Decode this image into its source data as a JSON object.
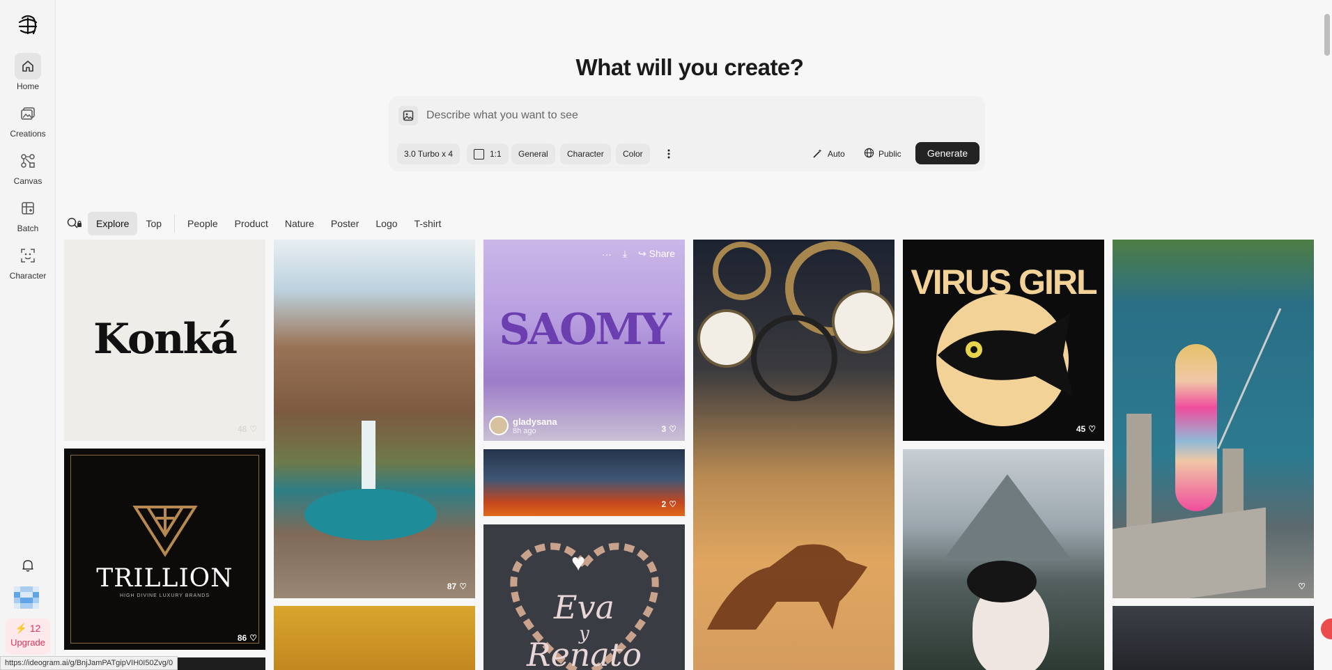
{
  "sidebar": {
    "items": [
      {
        "label": "Home",
        "icon": "home-icon",
        "active": true
      },
      {
        "label": "Creations",
        "icon": "images-icon"
      },
      {
        "label": "Canvas",
        "icon": "canvas-icon"
      },
      {
        "label": "Batch",
        "icon": "batch-icon"
      },
      {
        "label": "Character",
        "icon": "character-icon"
      }
    ],
    "credits": "12",
    "upgrade_label": "Upgrade"
  },
  "header": {
    "title": "What will you create?",
    "placeholder": "Describe what you want to see",
    "model": "3.0 Turbo x 4",
    "aspect": "1:1",
    "chips": [
      "General",
      "Character",
      "Color"
    ],
    "auto_label": "Auto",
    "visibility_label": "Public",
    "generate_label": "Generate"
  },
  "filters": {
    "primary": [
      "Explore",
      "Top"
    ],
    "categories": [
      "People",
      "Product",
      "Nature",
      "Poster",
      "Logo",
      "T-shirt"
    ]
  },
  "gallery": {
    "konka": {
      "text": "Konká",
      "likes": "48"
    },
    "trillion": {
      "text": "TRILLION",
      "sub": "HIGH DIVINE LUXURY BRANDS",
      "likes": "86"
    },
    "canyon": {
      "likes": "87"
    },
    "saomy": {
      "text": "SAOMY",
      "user": "gladysana",
      "time": "8h ago",
      "likes": "3",
      "share_label": "Share"
    },
    "hero": {
      "likes": "2"
    },
    "eva": {
      "line1": "Eva",
      "line2": "y",
      "line3": "Renato"
    },
    "virus": {
      "text": "VIRUS GIRL",
      "likes": "45"
    }
  },
  "status_url": "https://ideogram.ai/g/BnjJamPATgipVIH0I50Zvg/0",
  "colors": {
    "accent": "#232323",
    "upgrade": "#e0335a"
  }
}
